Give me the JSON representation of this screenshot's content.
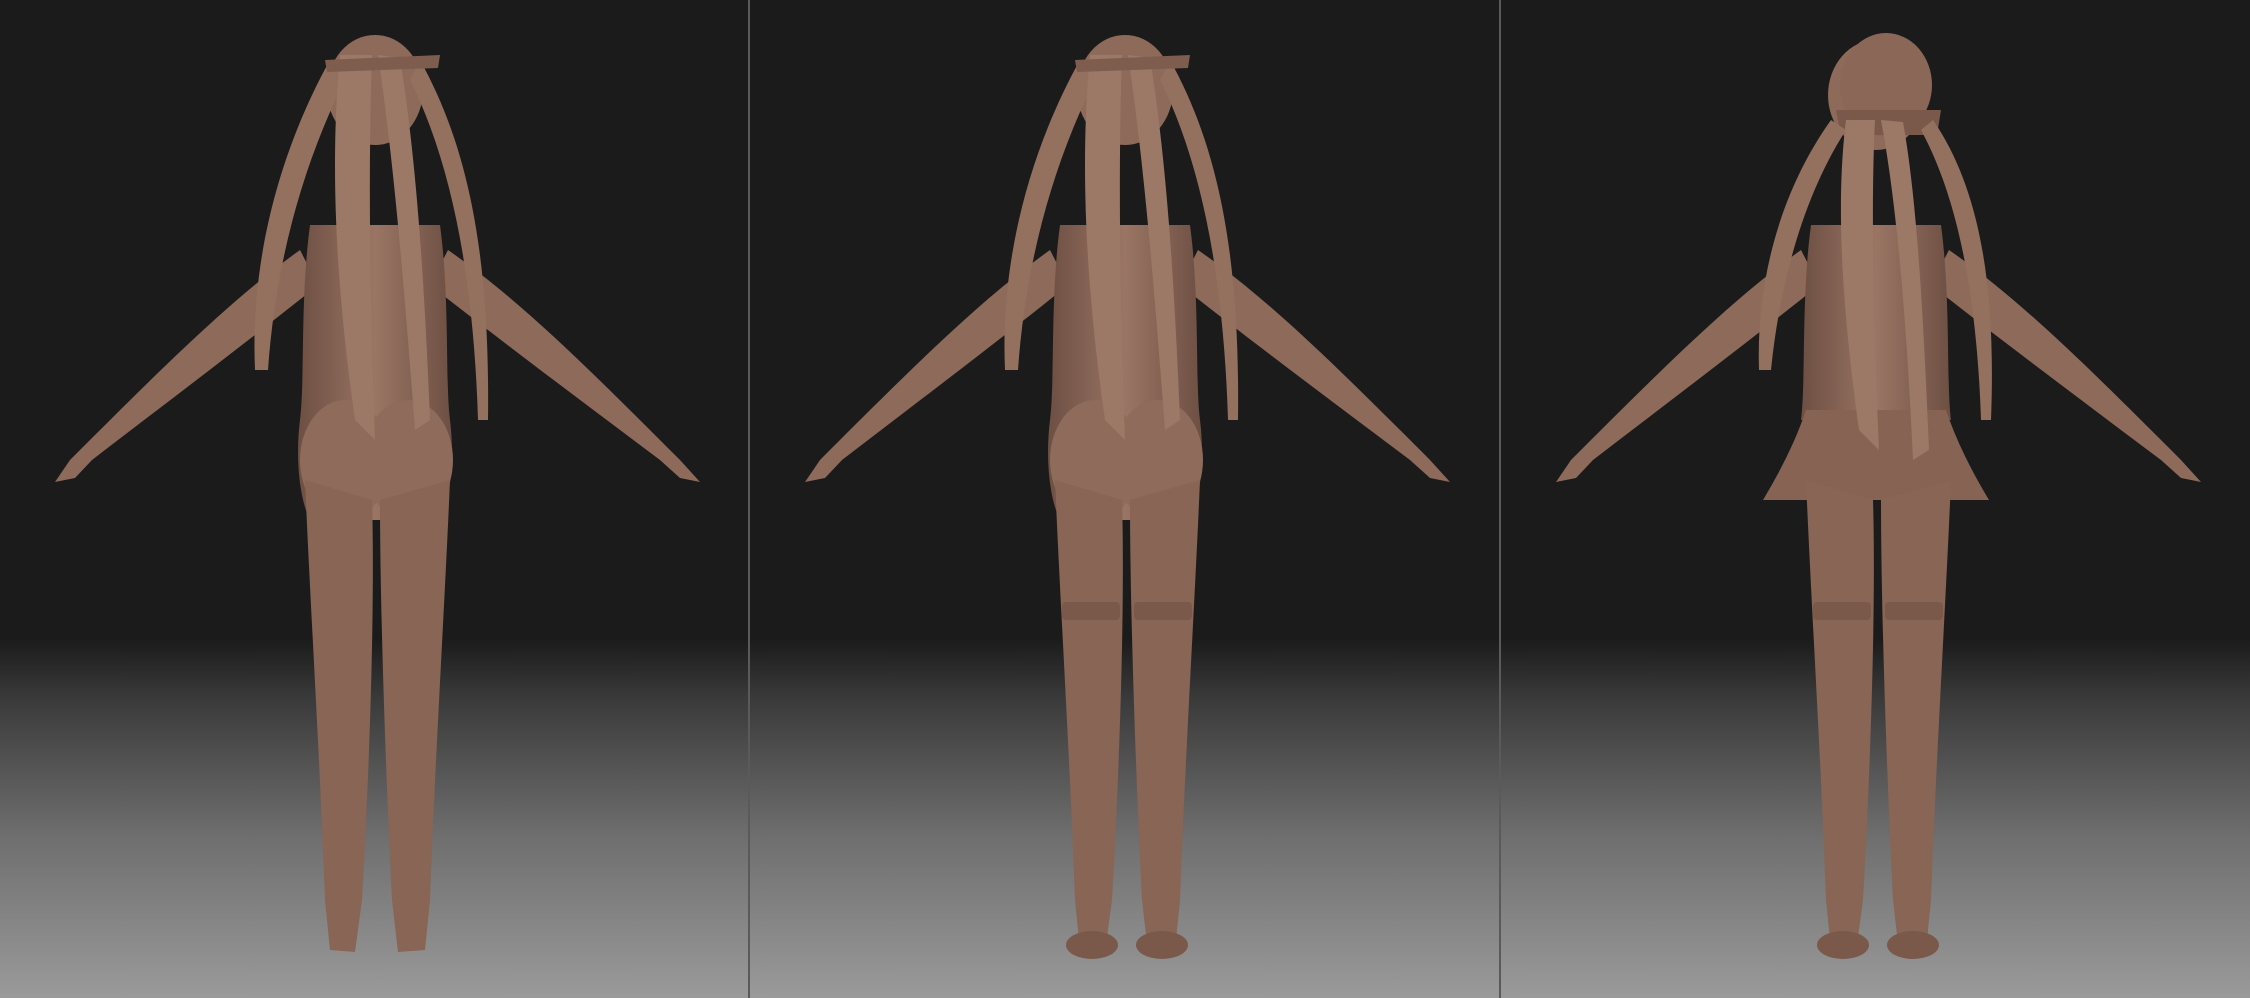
{
  "viewer": {
    "panels": [
      {
        "view": "back-no-clothes"
      },
      {
        "view": "back-stockings-shoes"
      },
      {
        "view": "back-full-outfit-hat"
      }
    ]
  },
  "colors": {
    "clay": "#8d6a5a",
    "clay_dark": "#6d4f43",
    "clay_light": "#a98676",
    "background_top": "#1b1b1b",
    "background_bottom": "#9a9a9a"
  }
}
